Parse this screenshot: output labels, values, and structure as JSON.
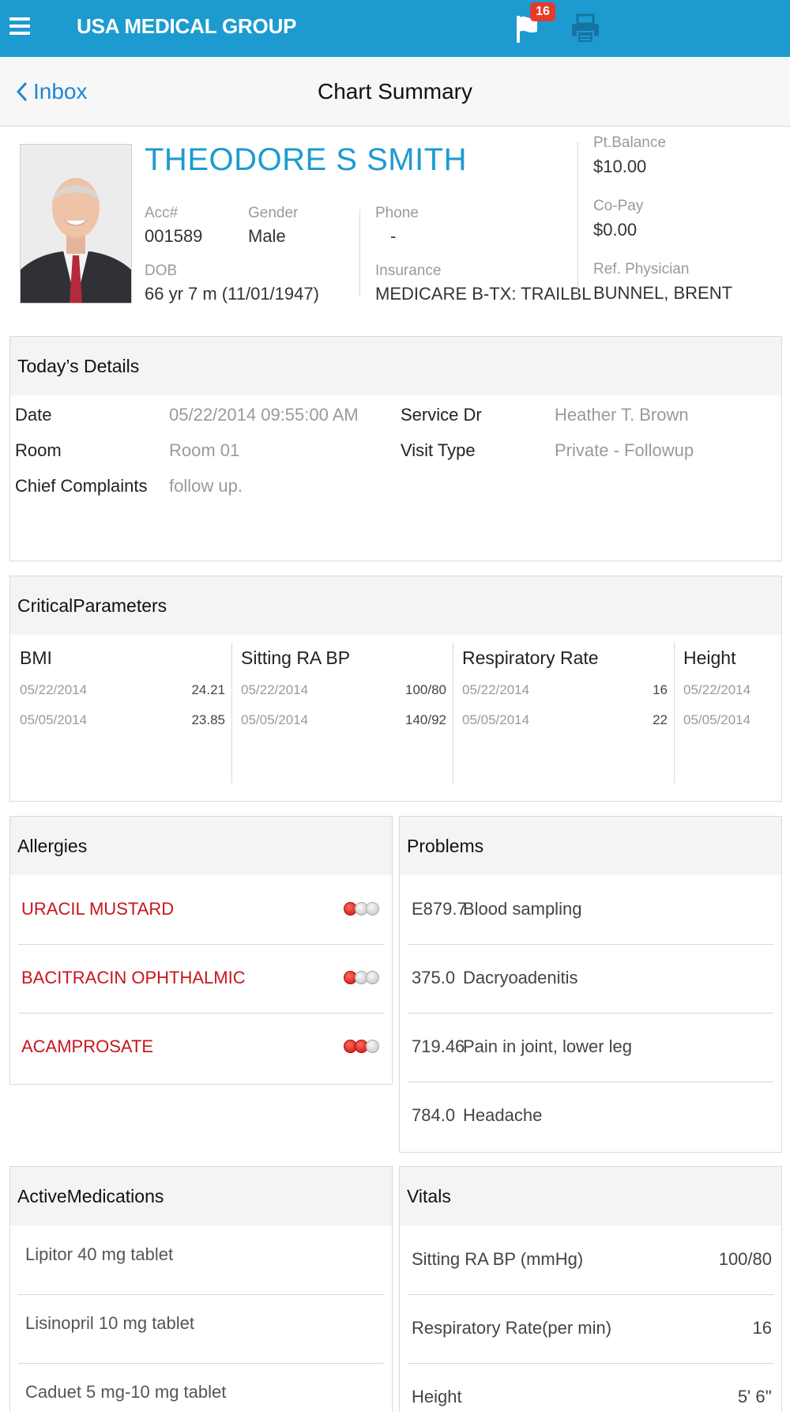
{
  "header": {
    "app_title": "USA MEDICAL GROUP",
    "flag_count": "16"
  },
  "nav": {
    "back_label": "Inbox",
    "title": "Chart Summary"
  },
  "patient": {
    "name": "THEODORE S SMITH",
    "acc_label": "Acc#",
    "acc": "001589",
    "gender_label": "Gender",
    "gender": "Male",
    "dob_label": "DOB",
    "dob": "66 yr 7 m (11/01/1947)",
    "phone_label": "Phone",
    "phone": "-",
    "insurance_label": "Insurance",
    "insurance": "MEDICARE B-TX: TRAILBL",
    "balance_label": "Pt.Balance",
    "balance": "$10.00",
    "copay_label": "Co-Pay",
    "copay": "$0.00",
    "refphys_label": "Ref. Physician",
    "refphys": "BUNNEL, BRENT"
  },
  "today": {
    "title": "Today’s Details",
    "date_label": "Date",
    "date": "05/22/2014 09:55:00 AM",
    "room_label": "Room",
    "room": "Room 01",
    "cc_label": "Chief Complaints",
    "cc": "follow up.",
    "servicedr_label": "Service Dr",
    "servicedr": "Heather T. Brown",
    "visittype_label": "Visit Type",
    "visittype": "Private - Followup"
  },
  "critical": {
    "title": "CriticalParameters",
    "params": [
      {
        "name": "BMI",
        "rows": [
          {
            "date": "05/22/2014",
            "value": "24.21"
          },
          {
            "date": "05/05/2014",
            "value": "23.85"
          }
        ]
      },
      {
        "name": "Sitting RA BP",
        "rows": [
          {
            "date": "05/22/2014",
            "value": "100/80"
          },
          {
            "date": "05/05/2014",
            "value": "140/92"
          }
        ]
      },
      {
        "name": "Respiratory Rate",
        "rows": [
          {
            "date": "05/22/2014",
            "value": "16"
          },
          {
            "date": "05/05/2014",
            "value": "22"
          }
        ]
      },
      {
        "name": "Height",
        "rows": [
          {
            "date": "05/22/2014",
            "value": ""
          },
          {
            "date": "05/05/2014",
            "value": ""
          }
        ]
      }
    ]
  },
  "allergies": {
    "title": "Allergies",
    "items": [
      {
        "name": "URACIL MUSTARD",
        "severity": 1
      },
      {
        "name": "BACITRACIN OPHTHALMIC",
        "severity": 1
      },
      {
        "name": "ACAMPROSATE",
        "severity": 2
      }
    ],
    "severity_color": "#c80f10"
  },
  "problems": {
    "title": "Problems",
    "items": [
      {
        "code": "E879.7",
        "desc": "Blood sampling"
      },
      {
        "code": "375.0",
        "desc": "Dacryoadenitis"
      },
      {
        "code": "719.46",
        "desc": "Pain in joint, lower leg"
      },
      {
        "code": "784.0",
        "desc": "Headache"
      }
    ]
  },
  "medications": {
    "title": "ActiveMedications",
    "items": [
      "Lipitor 40 mg tablet",
      "Lisinopril 10 mg tablet",
      "Caduet 5 mg-10 mg tablet"
    ]
  },
  "vitals": {
    "title": "Vitals",
    "items": [
      {
        "label": "Sitting RA BP (mmHg)",
        "value": "100/80"
      },
      {
        "label": "Respiratory Rate(per min)",
        "value": "16"
      },
      {
        "label": "Height",
        "value": "5' 6''"
      }
    ]
  },
  "colors": {
    "accent": "#1d9bd0",
    "link": "#1d88d6",
    "alert": "#c8161d",
    "badge": "#e53b2c"
  }
}
